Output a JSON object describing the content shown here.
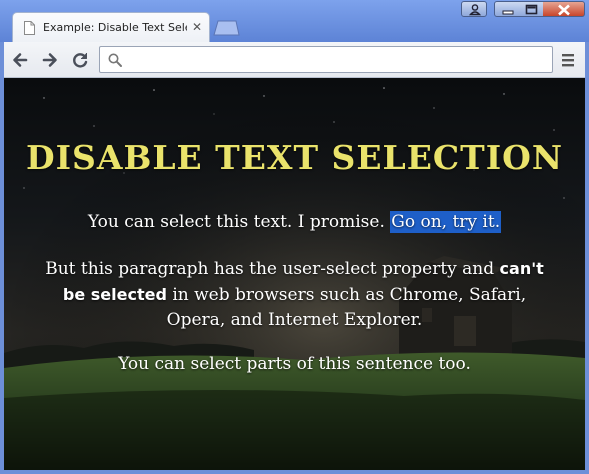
{
  "browser": {
    "tab_title": "Example: Disable Text Selec",
    "omnibox_value": "",
    "icons": {
      "tab": "file-icon",
      "tab_close": "close-icon",
      "back": "back-arrow-icon",
      "forward": "forward-arrow-icon",
      "reload": "reload-icon",
      "omnibox": "search-icon",
      "menu": "hamburger-menu-icon",
      "profile": "person-icon",
      "minimize": "minimize-icon",
      "maximize": "maximize-icon",
      "close": "close-window-icon"
    },
    "colors": {
      "frame": "#6d8fd8",
      "heading": "#eae36b",
      "selection": "#1e5fc8"
    }
  },
  "page": {
    "heading": "DISABLE TEXT SELECTION",
    "p1_text": "You can select this text. I promise.",
    "p1_selected": "Go on, try it.",
    "p2_start": "But this paragraph has the user-select property and",
    "p2_bold": "can't be selected",
    "p2_end": "in web browsers such as Chrome, Safari, Opera, and Internet Explorer.",
    "p3_text": "You can select parts of this sentence too."
  }
}
